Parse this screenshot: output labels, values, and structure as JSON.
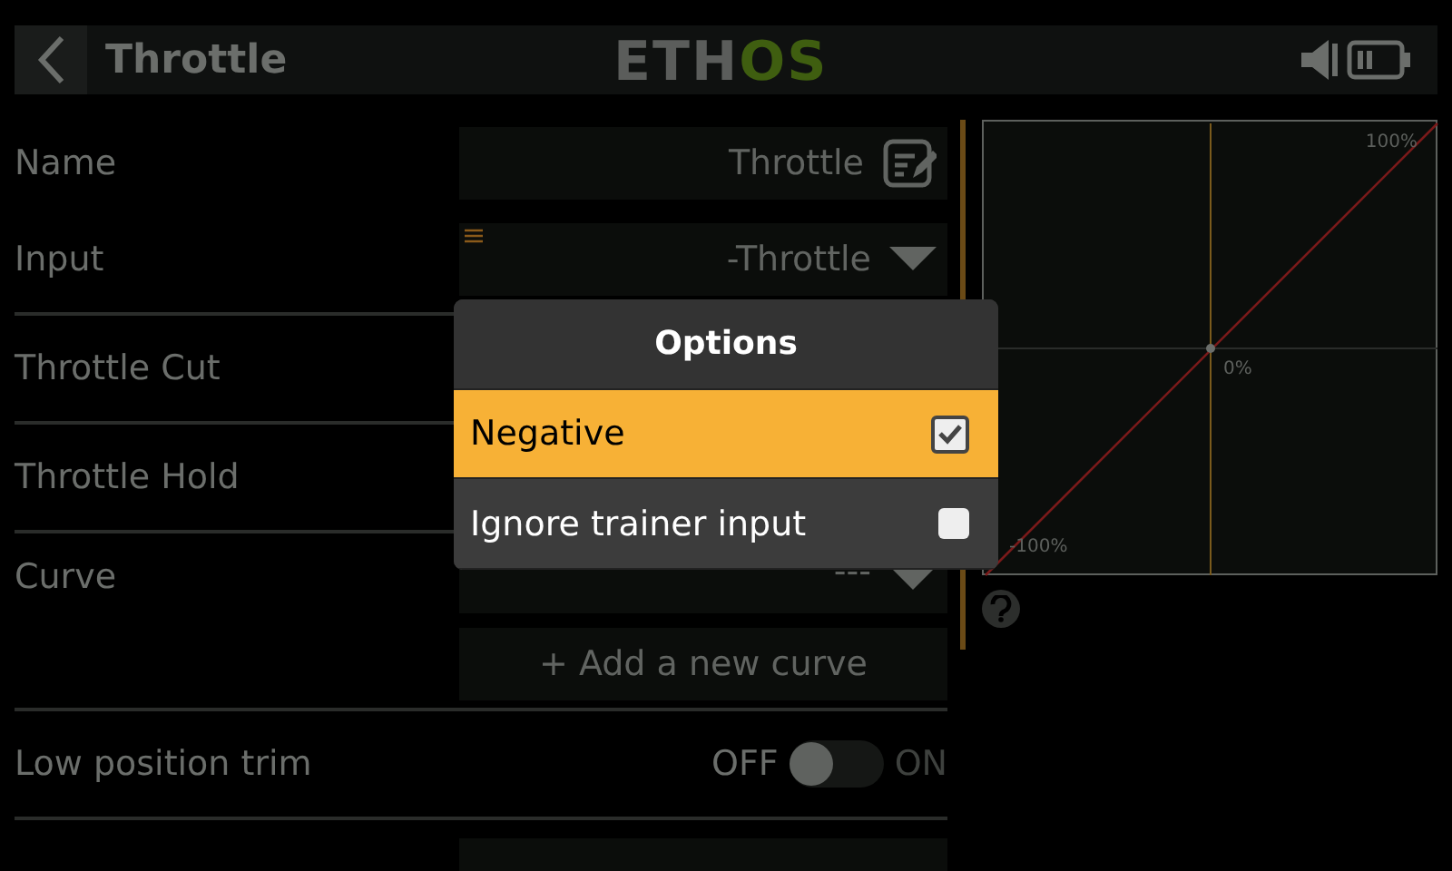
{
  "header": {
    "title": "Throttle",
    "logo": [
      "ETH",
      "OS"
    ]
  },
  "rows": [
    {
      "kind": "text",
      "label": "Name",
      "value": "Throttle"
    },
    {
      "kind": "source",
      "label": "Input",
      "value": "-Throttle"
    },
    {
      "kind": "hidden",
      "label": "Throttle Cut"
    },
    {
      "kind": "hidden",
      "label": "Throttle Hold"
    },
    {
      "kind": "choice",
      "label": "Curve",
      "value": "---"
    },
    {
      "kind": "action",
      "value": "+ Add a new curve"
    },
    {
      "kind": "toggle",
      "label": "Low position trim",
      "off_label": "OFF",
      "on_label": "ON",
      "on": false
    },
    {
      "kind": "empty"
    }
  ],
  "dialog": {
    "title": "Options",
    "items": [
      {
        "label": "Negative",
        "checked": true,
        "selected": true
      },
      {
        "label": "Ignore trainer input",
        "checked": false,
        "selected": false
      }
    ]
  },
  "graph": {
    "labels": [
      "100%",
      "0%",
      "-100%"
    ]
  }
}
